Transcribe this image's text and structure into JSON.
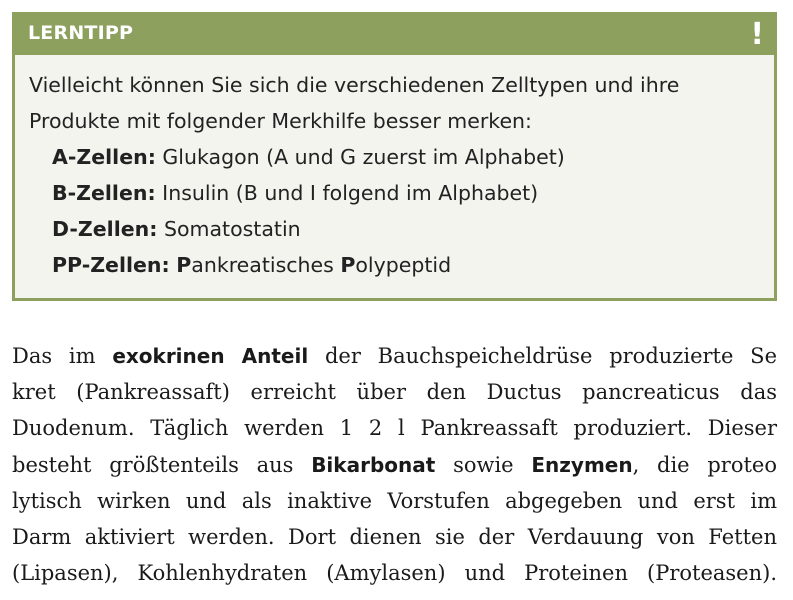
{
  "tip": {
    "title": "LERNTIPP",
    "mark": "!",
    "intro_line1": "Vielleicht können Sie sich die verschiedenen Zelltypen und ihre",
    "intro_line2": "Produkte mit folgender Merkhilfe besser merken:",
    "items": [
      {
        "label": "A-Zellen:",
        "text": " Glukagon (A und G zuerst im Alphabet)"
      },
      {
        "label": "B-Zellen:",
        "text": " Insulin (B und I folgend im Alphabet)"
      },
      {
        "label": "D-Zellen:",
        "text": " Somatostatin"
      },
      {
        "label": "PP-Zellen:",
        "text": " ",
        "p1": "P",
        "t1": "ankreatisches ",
        "p2": "P",
        "t2": "olypeptid"
      }
    ]
  },
  "paragraph": {
    "l1_a": "Das im ",
    "l1_b": "exokrinen Anteil",
    "l1_c": " der Bauchspeicheldrüse produzierte Se",
    "l2": "kret (Pankreassaft) erreicht über den Ductus pancreaticus das",
    "l3": "Duodenum. Täglich werden 1  2 l Pankreassaft produziert. Dieser",
    "l4_a": "besteht größtenteils aus ",
    "l4_b": "Bikarbonat",
    "l4_c": " sowie ",
    "l4_d": "Enzymen",
    "l4_e": ", die proteo",
    "l5": "lytisch wirken und als inaktive Vorstufen abgegeben und erst im",
    "l6": "Darm aktiviert werden. Dort dienen sie der Verdauung von Fetten",
    "l7": "(Lipasen), Kohlenhydraten (Amylasen) und Proteinen (Proteasen)."
  },
  "colors": {
    "accent": "#8da05e",
    "box_background": "#f3f4ee"
  }
}
